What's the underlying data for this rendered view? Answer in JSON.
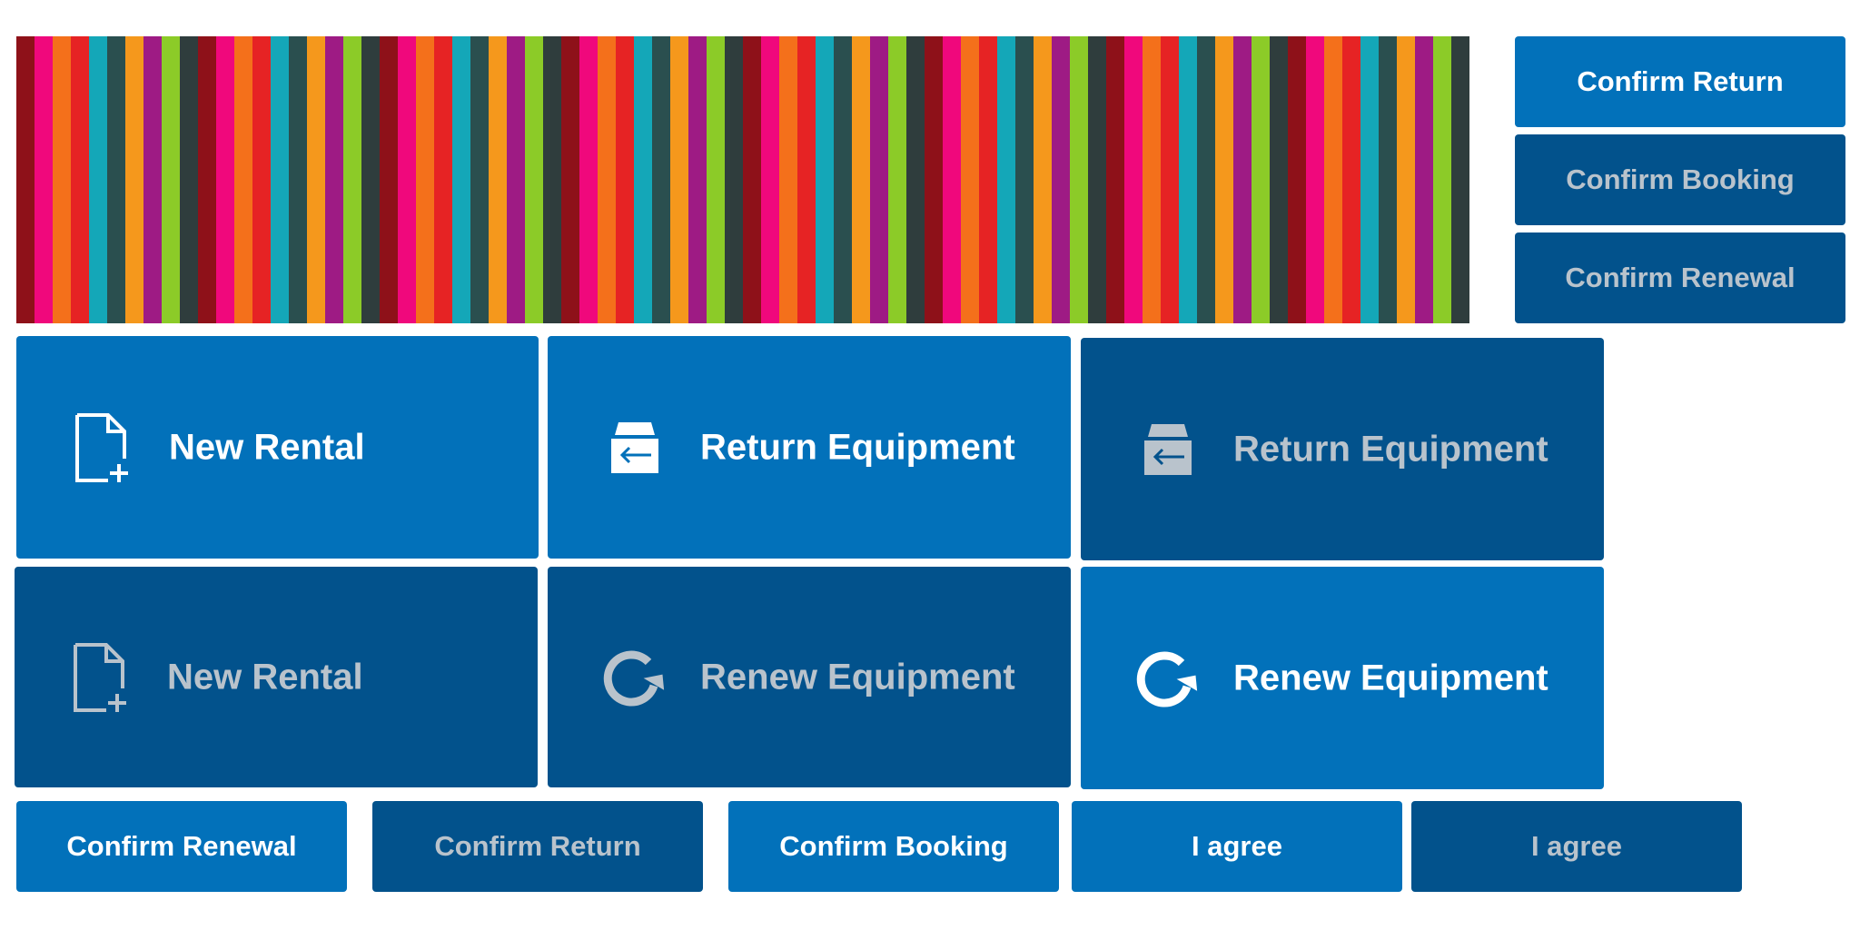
{
  "stripe_colors": [
    "#8E1119",
    "#F0087C",
    "#F4701B",
    "#E62324",
    "#14A7B8",
    "#2A4F4F",
    "#F5981C",
    "#9E1B84",
    "#8CCB28",
    "#2F3D3D"
  ],
  "stripe_count": 80,
  "right_buttons": [
    {
      "label": "Confirm Return",
      "state": "active"
    },
    {
      "label": "Confirm Booking",
      "state": "dim"
    },
    {
      "label": "Confirm Renewal",
      "state": "dim"
    }
  ],
  "tiles": [
    {
      "label": "New Rental",
      "icon": "new-document-icon",
      "state": "active"
    },
    {
      "label": "Return Equipment",
      "icon": "return-box-icon",
      "state": "active"
    },
    {
      "label": "Return Equipment",
      "icon": "return-box-icon",
      "state": "dim"
    },
    {
      "label": "New Rental",
      "icon": "new-document-icon",
      "state": "dim"
    },
    {
      "label": "Renew Equipment",
      "icon": "renew-arrow-icon",
      "state": "dim"
    },
    {
      "label": "Renew Equipment",
      "icon": "renew-arrow-icon",
      "state": "active"
    }
  ],
  "bottom_buttons": [
    {
      "label": "Confirm Renewal",
      "state": "active"
    },
    {
      "label": "Confirm Return",
      "state": "dim"
    },
    {
      "label": "Confirm Booking",
      "state": "active"
    },
    {
      "label": "I agree",
      "state": "active"
    },
    {
      "label": "I agree",
      "state": "dim"
    }
  ],
  "colors": {
    "active_bg": "#0271BA",
    "dim_bg": "#02528C",
    "active_text": "#FFFFFF",
    "dim_text": "#B9C3CC"
  }
}
